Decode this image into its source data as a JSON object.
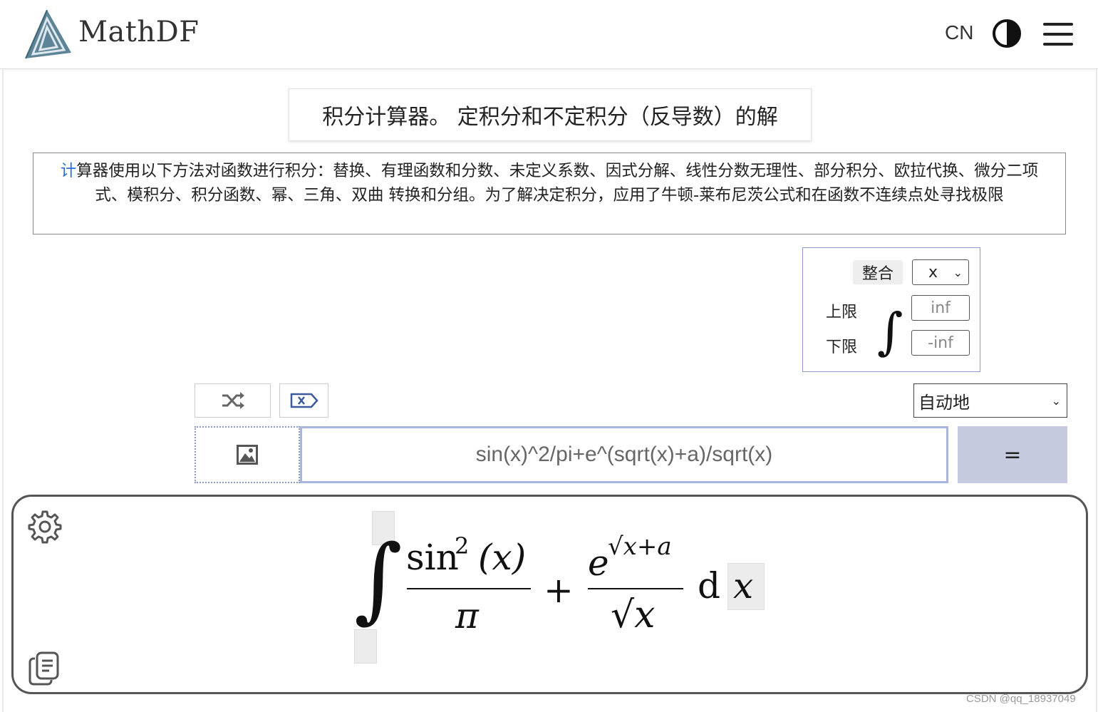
{
  "header": {
    "brand": "MathDF",
    "lang": "CN",
    "icons": [
      "logo-icon",
      "contrast-icon",
      "menu-icon"
    ]
  },
  "page": {
    "title": "积分计算器。 定积分和不定积分（反导数）的解",
    "description_first": "计",
    "description_rest": "算器使用以下方法对函数进行积分：替换、有理函数和分数、未定义系数、因式分解、线性分数无理性、部分积分、欧拉代换、微分二项式、模积分、积分函数、幂、三角、双曲 转换和分组。为了解决定积分，应用了牛顿-莱布尼茨公式和在函数不连续点处寻找极限"
  },
  "integral_panel": {
    "integrate_label": "整合",
    "variable": "x",
    "upper_label": "上限",
    "lower_label": "下限",
    "upper_placeholder": "inf",
    "lower_placeholder": "-inf",
    "integral_symbol": "∫"
  },
  "toolbar": {
    "icons": [
      "shuffle-icon",
      "clear-icon"
    ],
    "mode_value": "自动地"
  },
  "input": {
    "expression": "sin(x)^2/pi+e^(sqrt(x)+a)/sqrt(x)",
    "equals_label": "="
  },
  "result": {
    "icons": [
      "gear-icon",
      "copy-icon"
    ],
    "integral_sign": "∫",
    "num1": "sin",
    "num1_exp": "2",
    "num1_arg": "(𝑥)",
    "den1": "π",
    "plus": "+",
    "num2_base": "e",
    "num2_exp": "√𝑥+𝑎",
    "den2": "√𝑥",
    "d": "d",
    "var": "𝑥"
  },
  "watermark": "CSDN @qq_18937049"
}
